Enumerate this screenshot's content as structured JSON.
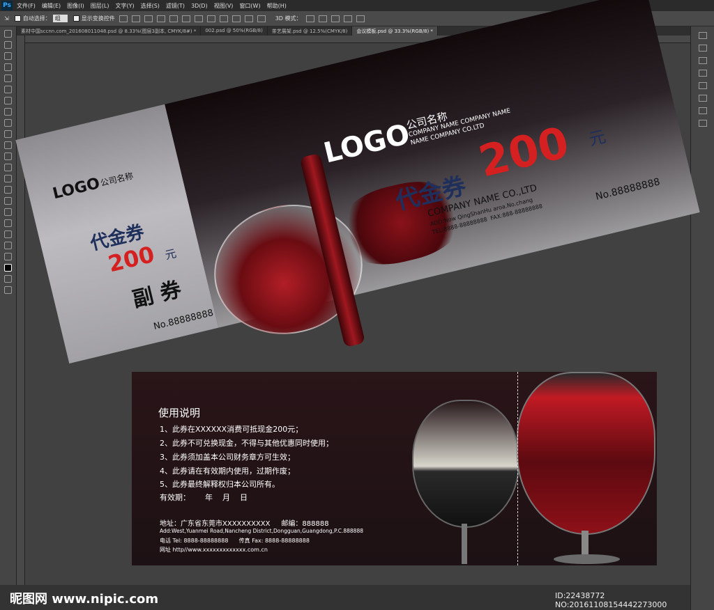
{
  "app": {
    "logo": "Ps"
  },
  "menu": [
    "文件(F)",
    "编辑(E)",
    "图像(I)",
    "图层(L)",
    "文字(Y)",
    "选择(S)",
    "滤镜(T)",
    "3D(D)",
    "视图(V)",
    "窗口(W)",
    "帮助(H)"
  ],
  "options": {
    "auto_select_label": "自动选择：",
    "auto_select_value": "组",
    "show_transform_label": "显示变换控件",
    "mode_3d_label": "3D 模式："
  },
  "tabs": [
    "素材中国sccnn.com_201608011048.psd @ 8.33%(图层3副本, CMYK/8#) *",
    "002.psd @ 50%(RGB/8)",
    "茶艺展架.psd @ 12.5%(CMYK/8)",
    "会议模板.psd @ 33.3%(RGB/8) *"
  ],
  "ticket_front": {
    "stub_logo": "LOGO",
    "stub_company": "公司名称",
    "stub_title": "代金券",
    "stub_amount": "200",
    "stub_unit": "元",
    "stub_label": "副 券",
    "stub_no": "No.88888888",
    "main_logo": "LOGO",
    "main_company_cn": "公司名称",
    "main_company_en1": "COMPANY NAME COMPANY NAME",
    "main_company_en2": "NAME COMPANY CO.LTD",
    "main_title": "代金券",
    "main_amount": "200",
    "main_unit": "元",
    "main_company3": "COMPANY NAME CO.,LTD",
    "main_add": "ADD:Now QingShanHu aroa.No.chang",
    "main_tel": "TEL:8888-88888888  FAX:888-88888888",
    "main_no": "No.88888888"
  },
  "ticket_back": {
    "heading": "使用说明",
    "rules": [
      "1、此券在XXXXXX消费可抵现金200元；",
      "2、此券不可兑换现金，不得与其他优惠同时使用；",
      "3、此券须加盖本公司财务章方可生效；",
      "4、此券请在有效期内使用，过期作废；",
      "5、此券最终解释权归本公司所有。"
    ],
    "validity": "有效期：      年    月    日",
    "address": "地址：广东省东莞市XXXXXXXXXX     邮编：888888",
    "address_en": "Add:West,Yuanmei Road,Nancheng District,Dongguan,Guangdong,P.C.888888",
    "phone": "电话 Tel: 8888-88888888      传真 Fax: 8888-88888888",
    "web": "网址 http//www.xxxxxxxxxxxxx.com.cn"
  },
  "watermark_left": "昵图网 www.nipic.com",
  "watermark_right": "ID:22438772 NO:20161108154442273000"
}
